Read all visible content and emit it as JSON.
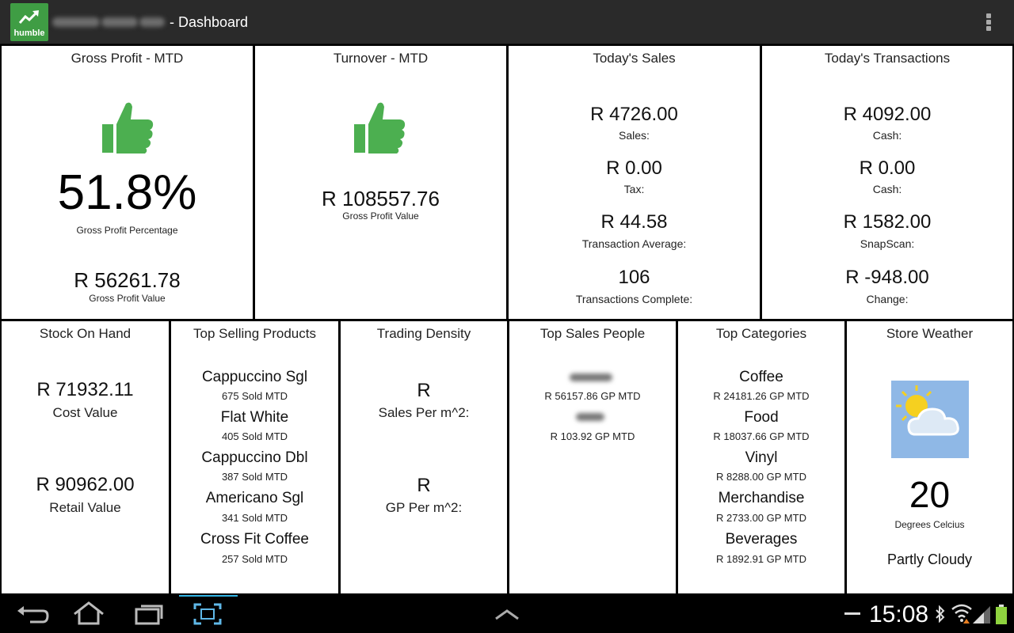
{
  "app": {
    "logo_text": "humble",
    "title_suffix": "- Dashboard"
  },
  "tiles": {
    "gross_profit": {
      "title": "Gross Profit - MTD",
      "icon": "thumbs-up-icon",
      "percentage": "51.8%",
      "percentage_label": "Gross Profit Percentage",
      "value": "R 56261.78",
      "value_label": "Gross Profit Value"
    },
    "turnover": {
      "title": "Turnover - MTD",
      "icon": "thumbs-up-icon",
      "value": "R 108557.76",
      "value_label": "Gross Profit Value"
    },
    "todays_sales": {
      "title": "Today's Sales",
      "items": [
        {
          "value": "R 4726.00",
          "label": "Sales:"
        },
        {
          "value": "R 0.00",
          "label": "Tax:"
        },
        {
          "value": "R 44.58",
          "label": "Transaction Average:"
        },
        {
          "value": "106",
          "label": "Transactions Complete:"
        }
      ]
    },
    "todays_transactions": {
      "title": "Today's Transactions",
      "items": [
        {
          "value": "R 4092.00",
          "label": "Cash:"
        },
        {
          "value": "R 0.00",
          "label": "Cash:"
        },
        {
          "value": "R 1582.00",
          "label": "SnapScan:"
        },
        {
          "value": "R -948.00",
          "label": "Change:"
        }
      ]
    },
    "stock_on_hand": {
      "title": "Stock On Hand",
      "cost_value": "R 71932.11",
      "cost_label": "Cost Value",
      "retail_value": "R 90962.00",
      "retail_label": "Retail Value"
    },
    "top_selling_products": {
      "title": "Top Selling Products",
      "items": [
        {
          "name": "Cappuccino Sgl",
          "detail": "675 Sold MTD"
        },
        {
          "name": "Flat White",
          "detail": "405 Sold MTD"
        },
        {
          "name": "Cappuccino Dbl",
          "detail": "387 Sold MTD"
        },
        {
          "name": "Americano Sgl",
          "detail": "341 Sold MTD"
        },
        {
          "name": "Cross Fit Coffee",
          "detail": "257 Sold MTD"
        }
      ]
    },
    "trading_density": {
      "title": "Trading Density",
      "sales_value": "R",
      "sales_label": "Sales Per m^2:",
      "gp_value": "R",
      "gp_label": "GP Per m^2:"
    },
    "top_sales_people": {
      "title": "Top Sales People",
      "items": [
        {
          "detail": "R 56157.86 GP MTD"
        },
        {
          "detail": "R 103.92 GP MTD"
        }
      ]
    },
    "top_categories": {
      "title": "Top Categories",
      "items": [
        {
          "name": "Coffee",
          "detail": "R 24181.26 GP MTD"
        },
        {
          "name": "Food",
          "detail": "R 18037.66 GP MTD"
        },
        {
          "name": "Vinyl",
          "detail": "R 8288.00 GP MTD"
        },
        {
          "name": "Merchandise",
          "detail": "R 2733.00 GP MTD"
        },
        {
          "name": "Beverages",
          "detail": "R 1892.91 GP MTD"
        }
      ]
    },
    "store_weather": {
      "title": "Store Weather",
      "icon": "partly-cloudy-icon",
      "temperature": "20",
      "unit_label": "Degrees Celcius",
      "condition": "Partly Cloudy"
    }
  },
  "system_bar": {
    "time": "15:08"
  },
  "colors": {
    "accent_green": "#3f9d44",
    "thumb_green": "#4caf50",
    "action_bar": "#2a2a2a",
    "nav_highlight": "#33b5e5"
  }
}
